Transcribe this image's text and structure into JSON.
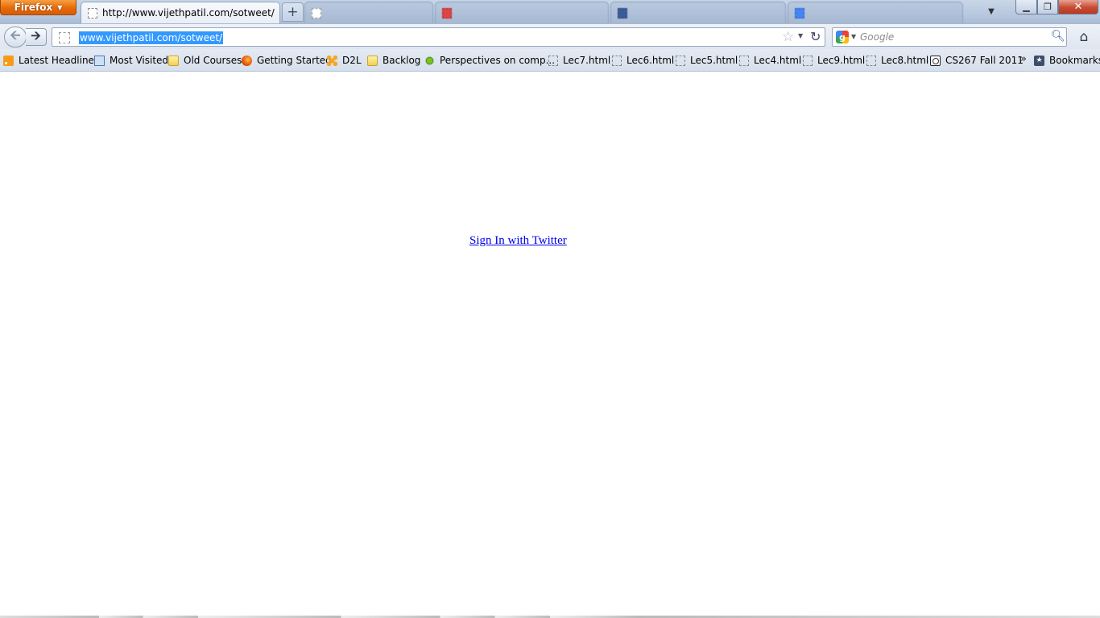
{
  "app_menu": {
    "label": "Firefox"
  },
  "tabs": [
    {
      "title": "http://www.vijethpatil.com/sotweet/",
      "active": true
    }
  ],
  "new_tab_label": "+",
  "window_controls": {
    "minimize": "▁",
    "maximize": "❐",
    "close": "✕"
  },
  "navigation": {
    "back_glyph": "🡨",
    "forward_glyph": "🡪"
  },
  "url_bar": {
    "value": "www.vijethpatil.com/sotweet/"
  },
  "search_bar": {
    "placeholder": "Google",
    "engine_letter": "g"
  },
  "bookmarks": [
    {
      "label": "Latest Headlines",
      "icon": "rss-icon"
    },
    {
      "label": "Most Visited",
      "icon": "most-visited-icon"
    },
    {
      "label": "Old Courses",
      "icon": "folder-icon"
    },
    {
      "label": "Getting Started",
      "icon": "firefox-icon"
    },
    {
      "label": "D2L",
      "icon": "d2l-icon"
    },
    {
      "label": "Backlog",
      "icon": "folder-icon"
    },
    {
      "label": "Perspectives on comp...",
      "icon": "green-burst-icon"
    },
    {
      "label": "Lec7.html",
      "icon": "page-icon"
    },
    {
      "label": "Lec6.html",
      "icon": "page-icon"
    },
    {
      "label": "Lec5.html",
      "icon": "page-icon"
    },
    {
      "label": "Lec4.html",
      "icon": "page-icon"
    },
    {
      "label": "Lec9.html",
      "icon": "page-icon"
    },
    {
      "label": "Lec8.html",
      "icon": "page-icon"
    },
    {
      "label": "CS267 Fall 2011",
      "icon": "cs-icon"
    }
  ],
  "bookmarks_overflow": "»",
  "bookmarks_menu": {
    "label": "Bookmarks"
  },
  "page": {
    "signin_link": "Sign In with Twitter"
  },
  "colors": {
    "accent_orange": "#e66a0b",
    "link_blue": "#0000ee",
    "selection_blue": "#3399ff"
  }
}
